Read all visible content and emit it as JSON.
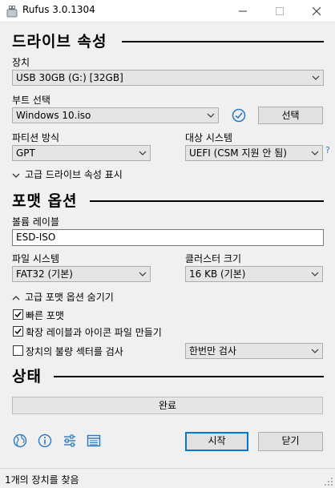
{
  "window": {
    "title": "Rufus 3.0.1304"
  },
  "drive_props": {
    "heading": "드라이브 속성",
    "device_label": "장치",
    "device_value": "USB 30GB (G:) [32GB]",
    "boot_label": "부트 선택",
    "boot_value": "Windows 10.iso",
    "select_button": "선택",
    "partition_label": "파티션 방식",
    "partition_value": "GPT",
    "target_label": "대상 시스템",
    "target_value": "UEFI (CSM 지원 안 됨)",
    "help_glyph": "?",
    "advanced_toggle": "고급 드라이브 속성 표시"
  },
  "format": {
    "heading": "포맷 옵션",
    "volume_label": "볼륨 레이블",
    "volume_value": "ESD-ISO",
    "fs_label": "파일 시스템",
    "fs_value": "FAT32 (기본)",
    "cluster_label": "클러스터 크기",
    "cluster_value": "16 KB (기본)",
    "advanced_toggle": "고급 포맷 옵션 숨기기",
    "quick_format": "빠른 포맷",
    "extended_label": "확장 레이블과 아이콘 파일 만들기",
    "bad_blocks": "장치의 불량 섹터를 검사",
    "passes_value": "한번만 검사"
  },
  "status": {
    "heading": "상태",
    "progress_text": "완료",
    "progress": 1.0
  },
  "actions": {
    "start": "시작",
    "close": "닫기"
  },
  "statusbar": {
    "text": "1개의 장치를 찾음"
  },
  "colors": {
    "accent": "#0078d7",
    "check_ok": "#2b79c2"
  }
}
